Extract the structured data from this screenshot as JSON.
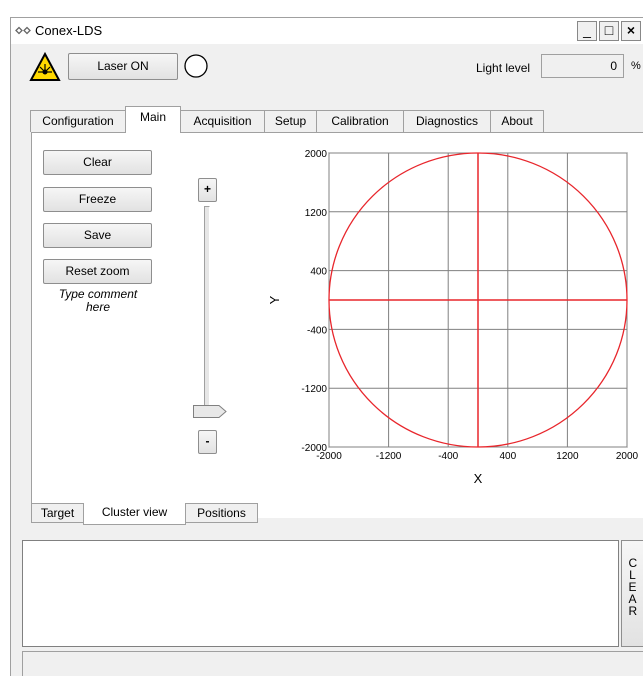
{
  "window": {
    "title": "Conex-LDS",
    "controls": {
      "minimize": "_",
      "maximize": "□",
      "close": "×"
    }
  },
  "toolbar": {
    "laser_button": "Laser ON",
    "light_level_label": "Light level",
    "light_level_value": "0",
    "light_level_unit": "%"
  },
  "tabs": [
    {
      "label": "Configuration",
      "active": false
    },
    {
      "label": "Main",
      "active": true
    },
    {
      "label": "Acquisition",
      "active": false
    },
    {
      "label": "Setup",
      "active": false
    },
    {
      "label": "Calibration",
      "active": false
    },
    {
      "label": "Diagnostics",
      "active": false
    },
    {
      "label": "About",
      "active": false
    }
  ],
  "main": {
    "buttons": {
      "clear": "Clear",
      "freeze": "Freeze",
      "save": "Save",
      "reset_zoom": "Reset zoom"
    },
    "comment": "Type comment here",
    "zoom_slider": {
      "plus": "+",
      "minus": "-",
      "level": 0
    }
  },
  "bottom_tabs": [
    {
      "label": "Target",
      "active": false
    },
    {
      "label": "Cluster view",
      "active": true
    },
    {
      "label": "Positions",
      "active": false
    }
  ],
  "log": {
    "clear_button": "CLEAR",
    "text": ""
  },
  "colors": {
    "plot_line": "#e8262c",
    "grid": "#808080"
  },
  "icons": [
    "link-icon",
    "laser-warning-icon",
    "laser-status-indicator-icon"
  ],
  "chart_data": {
    "type": "line",
    "title": "",
    "xlabel": "X",
    "ylabel": "Y",
    "xlim": [
      -2000,
      2000
    ],
    "ylim": [
      -2000,
      2000
    ],
    "x_ticks": [
      -2000,
      -1200,
      -400,
      400,
      1200,
      2000
    ],
    "y_ticks": [
      2000,
      1200,
      400,
      -400,
      -1200,
      -2000
    ],
    "grid": true,
    "circle": {
      "center": [
        0,
        0
      ],
      "radius": 2000
    },
    "crosshair": {
      "x": 0,
      "y": 0
    }
  }
}
